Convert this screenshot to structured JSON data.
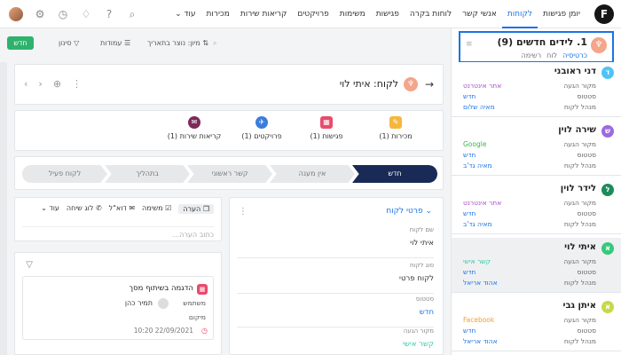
{
  "brand": {
    "logo_char": "F"
  },
  "nav": [
    {
      "label": "יומן פגישות",
      "active": false
    },
    {
      "label": "לקוחות",
      "active": true
    },
    {
      "label": "אנשי קשר",
      "active": false
    },
    {
      "label": "לוחות בקרה",
      "active": false
    },
    {
      "label": "פגישות",
      "active": false
    },
    {
      "label": "משימות",
      "active": false
    },
    {
      "label": "פרויקטים",
      "active": false
    },
    {
      "label": "קריאות שירות",
      "active": false
    },
    {
      "label": "מכירות",
      "active": false
    },
    {
      "label": "עוד",
      "active": false
    }
  ],
  "topicons": {
    "search": "⌕",
    "help": "?",
    "bell": "🔔",
    "settings": "⚙",
    "clock": "◷"
  },
  "sidebar": {
    "list_title": "1. לידים חדשים (9)",
    "views": [
      "כרטיסיה",
      "לוח",
      "רשימה"
    ],
    "labels": {
      "source": "מקור הגעה",
      "status": "סטטוס",
      "manager": "מנהל לקוח"
    },
    "leads": [
      {
        "initial": "ד",
        "name": "דני ראובני",
        "source": "אתר אינטרנט",
        "status": "חדש",
        "manager": "מאיה שלום",
        "avatar_color": "#4fc3f7",
        "source_color": "#a64dc8",
        "selected": false
      },
      {
        "initial": "ש",
        "name": "שירה לוין",
        "source": "Google",
        "status": "חדש",
        "manager": "מאיה גד'ב",
        "avatar_color": "#9c6ade",
        "source_color": "#3fb34f",
        "selected": false
      },
      {
        "initial": "ל",
        "name": "לידר לוין",
        "source": "אתר אינטרנט",
        "status": "חדש",
        "manager": "מאיה גד'ב",
        "avatar_color": "#1e8b5a",
        "source_color": "#a64dc8",
        "selected": false
      },
      {
        "initial": "א",
        "name": "איתי לוי",
        "source": "קשר אישי",
        "status": "חדש",
        "manager": "אהוד אריאל",
        "avatar_color": "#35c97b",
        "source_color": "#35c9a5",
        "selected": true
      },
      {
        "initial": "א",
        "name": "איתן גבי",
        "source": "Facebook",
        "status": "חדש",
        "manager": "אהוד אריאל",
        "avatar_color": "#c6d94a",
        "source_color": "#f0a030",
        "selected": false
      }
    ]
  },
  "toolbar": {
    "new_label": "חדש",
    "filter_label": "סינון",
    "columns_label": "עמודות",
    "sort_label": "מיון: נוצר בתאריך"
  },
  "lead": {
    "title": "לקוח: איתי לוי",
    "stats": [
      {
        "label": "מכירות (1)",
        "color": "#f6b73c",
        "icon": "✎"
      },
      {
        "label": "פגישות (1)",
        "color": "#e94b6b",
        "icon": "▦"
      },
      {
        "label": "פרויקטים (1)",
        "color": "#3b7ddd",
        "icon": "✈"
      },
      {
        "label": "קריאות שירות (1)",
        "color": "#7b2a5a",
        "icon": "✉"
      }
    ],
    "stages": [
      "חדש",
      "אין מענה",
      "קשר ראשוני",
      "בתהליך",
      "לקוח פעיל"
    ],
    "active_stage": 0
  },
  "details": {
    "header": "פרטי לקוח",
    "fields": [
      {
        "label": "שם לקוח",
        "value": "איתי לוי",
        "color": "#333"
      },
      {
        "label": "סוג לקוח",
        "value": "לקוח פרטי",
        "color": "#333"
      },
      {
        "label": "סטטוס",
        "value": "חדש",
        "color": "#1a73e8"
      },
      {
        "label": "מקור הגעה",
        "value": "קשר אישי",
        "color": "#35c9a5"
      }
    ]
  },
  "notes": {
    "tabs": [
      "הערה",
      "משימה",
      "דוא\"ל",
      "לוג שיחה",
      "עוד"
    ],
    "placeholder": "כתוב הערה..."
  },
  "activity": {
    "title": "הדגמה בשיתוף מסך",
    "user_label": "משתמש",
    "user_name": "תמיר כהן",
    "location_label": "מיקום",
    "date": "22/09/2021 10:20"
  }
}
